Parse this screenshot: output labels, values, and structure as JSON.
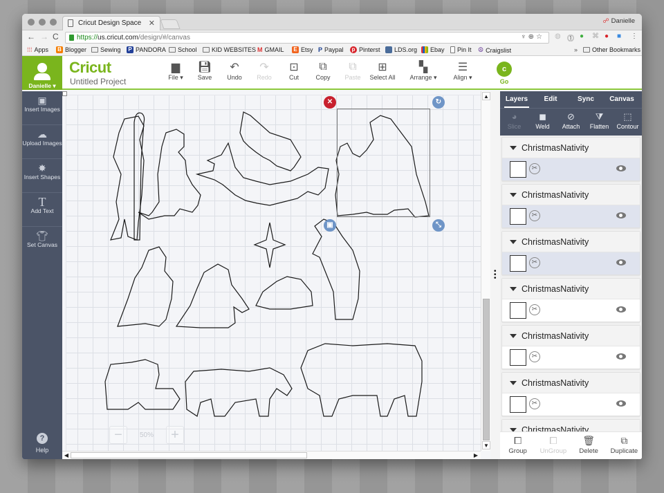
{
  "browser": {
    "tab_title": "Cricut Design Space",
    "profile_name": "Danielle",
    "url_proto": "https://",
    "url_host": "us.cricut.com",
    "url_path": "/design/#/canvas",
    "bookmarks": [
      "Apps",
      "Blogger",
      "Sewing",
      "PANDORA",
      "School",
      "KID WEBSITES",
      "GMAIL",
      "Etsy",
      "Paypal",
      "Pinterst",
      "LDS.org",
      "Ebay",
      "Pin It",
      "Craigslist"
    ],
    "other_bookmarks": "Other Bookmarks"
  },
  "app": {
    "user_name": "Danielle",
    "logo": "Cricut",
    "project_title": "Untitled Project",
    "toolbar": {
      "file": "File",
      "save": "Save",
      "undo": "Undo",
      "redo": "Redo",
      "cut": "Cut",
      "copy": "Copy",
      "paste": "Paste",
      "select_all": "Select All",
      "arrange": "Arrange",
      "align": "Align",
      "go": "Go"
    },
    "sidebar": [
      {
        "label": "Insert Images",
        "icon": "image-icon"
      },
      {
        "label": "Upload Images",
        "icon": "cloud-upload-icon"
      },
      {
        "label": "Insert Shapes",
        "icon": "shapes-icon"
      },
      {
        "label": "Add Text",
        "icon": "text-icon"
      },
      {
        "label": "Set Canvas",
        "icon": "shirt-icon"
      }
    ],
    "help": "Help",
    "zoom_level": "50%",
    "panel_tabs": [
      "Layers",
      "Edit",
      "Sync",
      "Canvas"
    ],
    "panel_tools": [
      {
        "label": "Slice",
        "enabled": false
      },
      {
        "label": "Weld",
        "enabled": true
      },
      {
        "label": "Attach",
        "enabled": true
      },
      {
        "label": "Flatten",
        "enabled": true
      },
      {
        "label": "Contour",
        "enabled": true
      }
    ],
    "layers": [
      {
        "name": "ChristmasNativity",
        "selected": true
      },
      {
        "name": "ChristmasNativity",
        "selected": true
      },
      {
        "name": "ChristmasNativity",
        "selected": true
      },
      {
        "name": "ChristmasNativity",
        "selected": false
      },
      {
        "name": "ChristmasNativity",
        "selected": false
      },
      {
        "name": "ChristmasNativity",
        "selected": false
      },
      {
        "name": "ChristmasNativity",
        "selected": false
      }
    ],
    "bottom_actions": [
      {
        "label": "Group",
        "enabled": true
      },
      {
        "label": "UnGroup",
        "enabled": false
      },
      {
        "label": "Delete",
        "enabled": true
      },
      {
        "label": "Duplicate",
        "enabled": true
      }
    ]
  },
  "colors": {
    "brand_green": "#7ab51d",
    "sidebar_slate": "#4b5467",
    "delete_red": "#c8202e",
    "handle_blue": "#6f95c7"
  }
}
